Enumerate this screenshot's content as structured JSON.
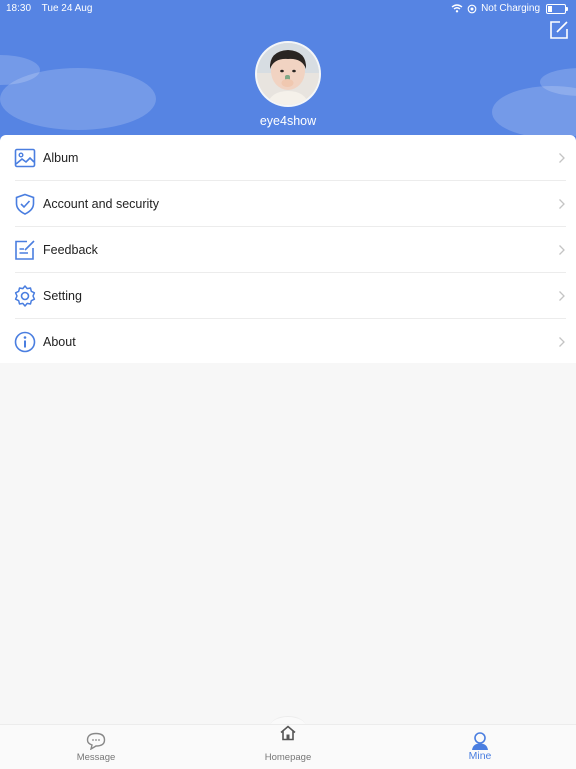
{
  "status_bar": {
    "time": "18:30",
    "date": "Tue 24 Aug",
    "charging": "Not Charging"
  },
  "profile": {
    "username": "eye4show"
  },
  "menu": {
    "items": [
      {
        "label": "Album",
        "icon": "album-icon"
      },
      {
        "label": "Account and security",
        "icon": "shield-icon"
      },
      {
        "label": "Feedback",
        "icon": "feedback-icon"
      },
      {
        "label": "Setting",
        "icon": "gear-icon"
      },
      {
        "label": "About",
        "icon": "info-icon"
      }
    ]
  },
  "tabbar": {
    "tabs": [
      {
        "label": "Message",
        "icon": "message-icon"
      },
      {
        "label": "Homepage",
        "icon": "home-icon"
      },
      {
        "label": "Mine",
        "icon": "person-icon"
      }
    ],
    "active": "Mine"
  },
  "colors": {
    "header": "#5684e3",
    "accent": "#4a7ee0"
  }
}
